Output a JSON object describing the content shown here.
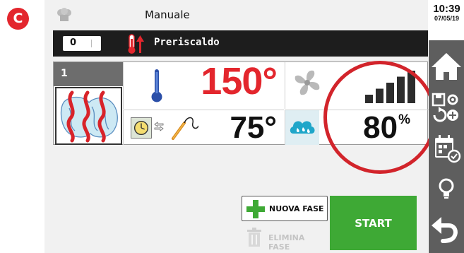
{
  "badge": {
    "letter": "C"
  },
  "header": {
    "mode_title": "Manuale"
  },
  "clock": {
    "time": "10:39",
    "date": "07/05/19"
  },
  "status": {
    "counter_value": "0",
    "preheat_label": "Preriscaldo"
  },
  "phase": {
    "number": "1"
  },
  "cooking": {
    "chamber_temperature": "150°",
    "probe_temperature": "75°",
    "humidity_value": "80",
    "humidity_unit": "%",
    "fan_speed_level": 5,
    "fan_speed_max": 5
  },
  "actions": {
    "new_phase_label": "NUOVA FASE",
    "delete_phase_label": "ELIMINA FASE",
    "start_label": "START"
  },
  "sidebar": {
    "items": [
      {
        "icon": "home-icon"
      },
      {
        "icon": "save-settings-add-icon"
      },
      {
        "icon": "calendar-icon"
      },
      {
        "icon": "lightbulb-icon"
      },
      {
        "icon": "back-arrow-icon"
      }
    ]
  },
  "colors": {
    "accent_red": "#e3262d",
    "start_green": "#3ea935",
    "sidebar_gray": "#5e5e5e",
    "status_bar": "#1d1d1d"
  }
}
